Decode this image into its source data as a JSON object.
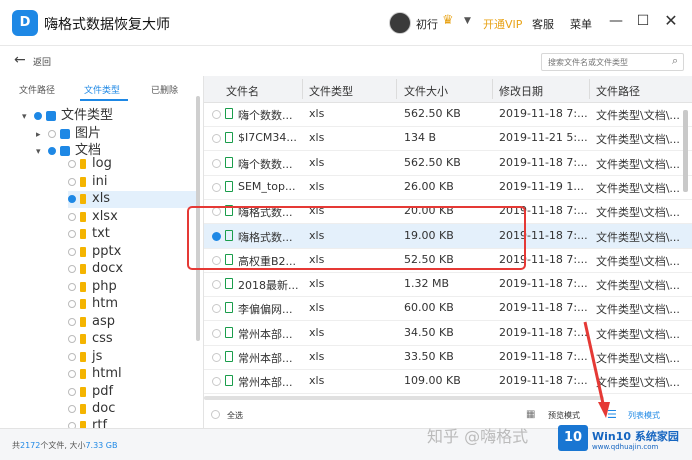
{
  "app": {
    "logo_text": "D",
    "title": "嗨格式数据恢复大师"
  },
  "user": {
    "name": "初行",
    "vip_label": "开通VIP",
    "service_label": "客服",
    "menu_label": "菜单"
  },
  "window": {
    "minimize": "—",
    "maximize": "☐",
    "close": "✕"
  },
  "toolbar": {
    "back_label": "返回",
    "search_placeholder": "搜索文件名或文件类型"
  },
  "left_tabs": [
    "文件路径",
    "文件类型",
    "已删除"
  ],
  "tree": {
    "root": "文件类型",
    "images": "图片",
    "docs": "文档",
    "items": [
      "log",
      "ini",
      "xls",
      "xlsx",
      "txt",
      "pptx",
      "docx",
      "php",
      "htm",
      "asp",
      "css",
      "js",
      "html",
      "pdf",
      "doc",
      "rtf"
    ]
  },
  "table": {
    "headers": [
      "文件名",
      "文件类型",
      "文件大小",
      "修改日期",
      "文件路径"
    ],
    "rows": [
      {
        "name": "嗨个数数...",
        "type": "xls",
        "size": "562.50 KB",
        "date": "2019-11-18 7:...",
        "path": "文件类型\\文档\\..."
      },
      {
        "name": "$I7CM34...",
        "type": "xls",
        "size": "134 B",
        "date": "2019-11-21 5:...",
        "path": "文件类型\\文档\\..."
      },
      {
        "name": "嗨个数数...",
        "type": "xls",
        "size": "562.50 KB",
        "date": "2019-11-18 7:...",
        "path": "文件类型\\文档\\..."
      },
      {
        "name": "SEM_top...",
        "type": "xls",
        "size": "26.00 KB",
        "date": "2019-11-19 1...",
        "path": "文件类型\\文档\\..."
      },
      {
        "name": "嗨格式数...",
        "type": "xls",
        "size": "20.00 KB",
        "date": "2019-11-18 7:...",
        "path": "文件类型\\文档\\..."
      },
      {
        "name": "嗨格式数...",
        "type": "xls",
        "size": "19.00 KB",
        "date": "2019-11-18 7:...",
        "path": "文件类型\\文档\\..."
      },
      {
        "name": "高权重B2...",
        "type": "xls",
        "size": "52.50 KB",
        "date": "2019-11-18 7:...",
        "path": "文件类型\\文档\\..."
      },
      {
        "name": "2018最新...",
        "type": "xls",
        "size": "1.32 MB",
        "date": "2019-11-18 7:...",
        "path": "文件类型\\文档\\..."
      },
      {
        "name": "李偏偏网...",
        "type": "xls",
        "size": "60.00 KB",
        "date": "2019-11-18 7:...",
        "path": "文件类型\\文档\\..."
      },
      {
        "name": "常州本部...",
        "type": "xls",
        "size": "34.50 KB",
        "date": "2019-11-18 7:...",
        "path": "文件类型\\文档\\..."
      },
      {
        "name": "常州本部...",
        "type": "xls",
        "size": "33.50 KB",
        "date": "2019-11-18 7:...",
        "path": "文件类型\\文档\\..."
      },
      {
        "name": "常州本部...",
        "type": "xls",
        "size": "109.00 KB",
        "date": "2019-11-18 7:...",
        "path": "文件类型\\文档\\..."
      }
    ],
    "selected_row": 5
  },
  "bottom": {
    "select_all": "全选",
    "thumb_mode": "预览模式",
    "list_mode": "列表模式"
  },
  "status": {
    "prefix": "共",
    "count": "2172",
    "mid": "个文件, 大小",
    "size": "7.33 GB"
  },
  "watermark": {
    "zhihu": "知乎 @嗨格式",
    "logo": "10",
    "site": "Win10 系统家园",
    "url": "www.qdhuajin.com"
  },
  "colors": {
    "accent": "#1e88e5",
    "annotation": "#e53935",
    "vip": "#e8a317"
  }
}
